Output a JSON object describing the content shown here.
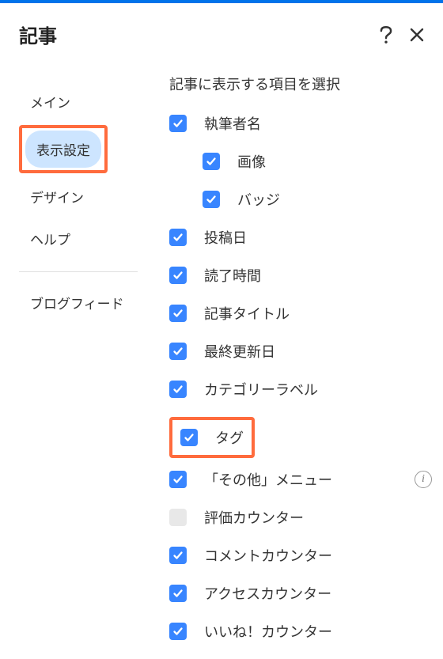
{
  "header": {
    "title": "記事"
  },
  "sidebar": {
    "items": [
      {
        "label": "メイン"
      },
      {
        "label": "表示設定"
      },
      {
        "label": "デザイン"
      },
      {
        "label": "ヘルプ"
      }
    ],
    "footer_link": "ブログフィード"
  },
  "main": {
    "section_title": "記事に表示する項目を選択",
    "options": [
      {
        "label": "執筆者名",
        "checked": true
      },
      {
        "label": "画像",
        "checked": true,
        "nested": true
      },
      {
        "label": "バッジ",
        "checked": true,
        "nested": true
      },
      {
        "label": "投稿日",
        "checked": true
      },
      {
        "label": "読了時間",
        "checked": true
      },
      {
        "label": "記事タイトル",
        "checked": true
      },
      {
        "label": "最終更新日",
        "checked": true
      },
      {
        "label": "カテゴリーラベル",
        "checked": true
      },
      {
        "label": "タグ",
        "checked": true,
        "highlighted": true
      },
      {
        "label": "「その他」メニュー",
        "checked": true,
        "info": true
      },
      {
        "label": "評価カウンター",
        "checked": false
      },
      {
        "label": "コメントカウンター",
        "checked": true
      },
      {
        "label": "アクセスカウンター",
        "checked": true
      },
      {
        "label": "いいね！カウンター",
        "checked": true
      }
    ]
  }
}
